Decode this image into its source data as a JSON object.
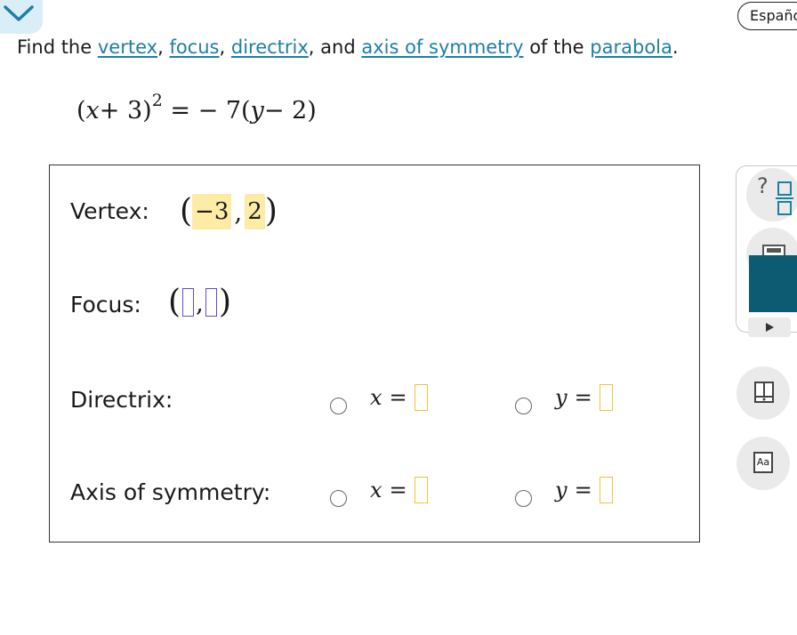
{
  "language_button": {
    "label": "Español"
  },
  "instructions": {
    "find": "Find the",
    "vertex": "vertex",
    "comma1": ",",
    "focus": "focus",
    "comma2": ",",
    "directrix": "directrix",
    "and": ", and",
    "axis": "axis of symmetry",
    "of_the": "of the",
    "parabola": "parabola",
    "period": "."
  },
  "equation": {
    "open": "(",
    "x": "x",
    "plus3": "+ 3",
    "close": ")",
    "exp": "2",
    "eq": "= − 7",
    "open2": "(",
    "y": "y",
    "minus2": "− 2",
    "close2": ")"
  },
  "rows": {
    "vertex": {
      "label": "Vertex:",
      "x_value": "−3",
      "comma": ",",
      "y_value": "2",
      "open": "(",
      "close": ")"
    },
    "focus": {
      "label": "Focus:",
      "open": "(",
      "comma": ",",
      "close": ")"
    },
    "directrix": {
      "label": "Directrix:",
      "opt1_var": "x",
      "opt2_var": "y",
      "eq": "="
    },
    "axis": {
      "label": "Axis of symmetry:",
      "opt1_var": "x",
      "opt2_var": "y",
      "eq": "="
    }
  },
  "tools": {
    "fraction_question": "?",
    "font_button": "Aa"
  },
  "colors": {
    "link": "#1c7fa6",
    "answer_fill": "#fdeba6",
    "active_box": "#5b4ed0",
    "inactive_box": "#ebc63b",
    "teal": "#0d5b73"
  }
}
